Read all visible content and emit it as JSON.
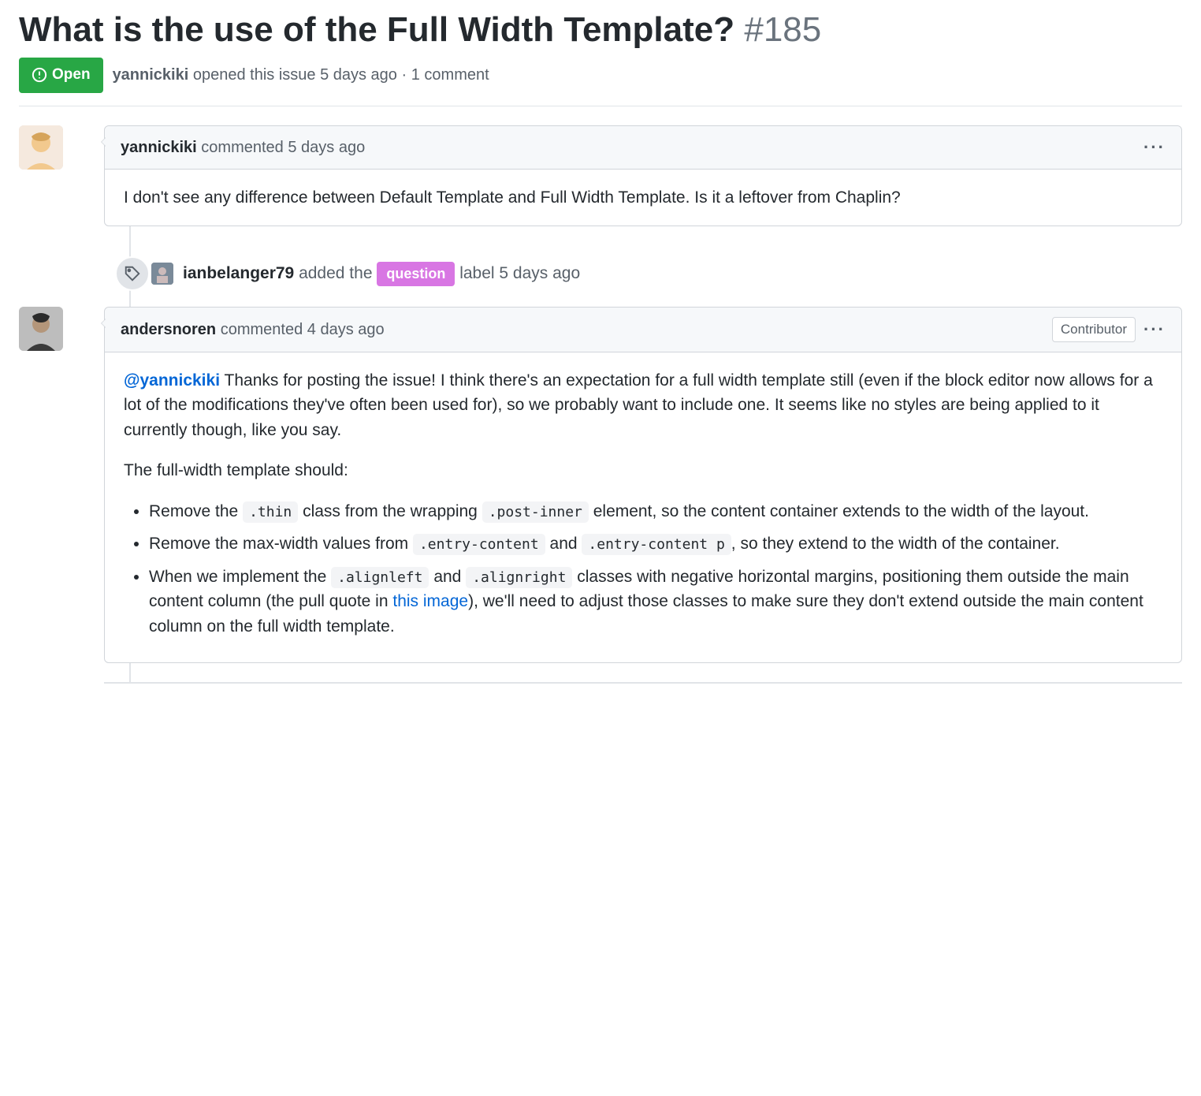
{
  "issue": {
    "title": "What is the use of the Full Width Template?",
    "number": "#185",
    "state": "Open",
    "author": "yannickiki",
    "opened_text": "opened this issue",
    "opened_ago": "5 days ago",
    "separator": "·",
    "comment_count_text": "1 comment"
  },
  "timeline": [
    {
      "type": "comment",
      "author": "yannickiki",
      "action": "commented",
      "time": "5 days ago",
      "role": null,
      "body_plain": "I don't see any difference between Default Template and Full Width Template. Is it a leftover from Chaplin?"
    },
    {
      "type": "label_event",
      "author": "ianbelanger79",
      "added_text": "added the",
      "label": "question",
      "label_color": "#d876e3",
      "label_suffix": "label",
      "time": "5 days ago"
    },
    {
      "type": "comment",
      "author": "andersnoren",
      "action": "commented",
      "time": "4 days ago",
      "role": "Contributor",
      "body": {
        "mention": "@yannickiki",
        "intro": " Thanks for posting the issue! I think there's an expectation for a full width template still (even if the block editor now allows for a lot of the modifications they've often been used for), so we probably want to include one. It seems like no styles are being applied to it currently though, like you say.",
        "subhead": "The full-width template should:",
        "bullets": [
          {
            "pre": "Remove the ",
            "code1": ".thin",
            "mid1": " class from the wrapping ",
            "code2": ".post-inner",
            "post": " element, so the content container extends to the width of the layout."
          },
          {
            "pre": "Remove the max-width values from ",
            "code1": ".entry-content",
            "mid1": " and ",
            "code2": ".entry-content p",
            "post": ", so they extend to the width of the container."
          },
          {
            "pre": "When we implement the ",
            "code1": ".alignleft",
            "mid1": " and ",
            "code2": ".alignright",
            "mid2": " classes with negative horizontal margins, positioning them outside the main content column (the pull quote in ",
            "link_text": "this image",
            "post": "), we'll need to adjust those classes to make sure they don't extend outside the main content column on the full width template."
          }
        ]
      }
    }
  ]
}
